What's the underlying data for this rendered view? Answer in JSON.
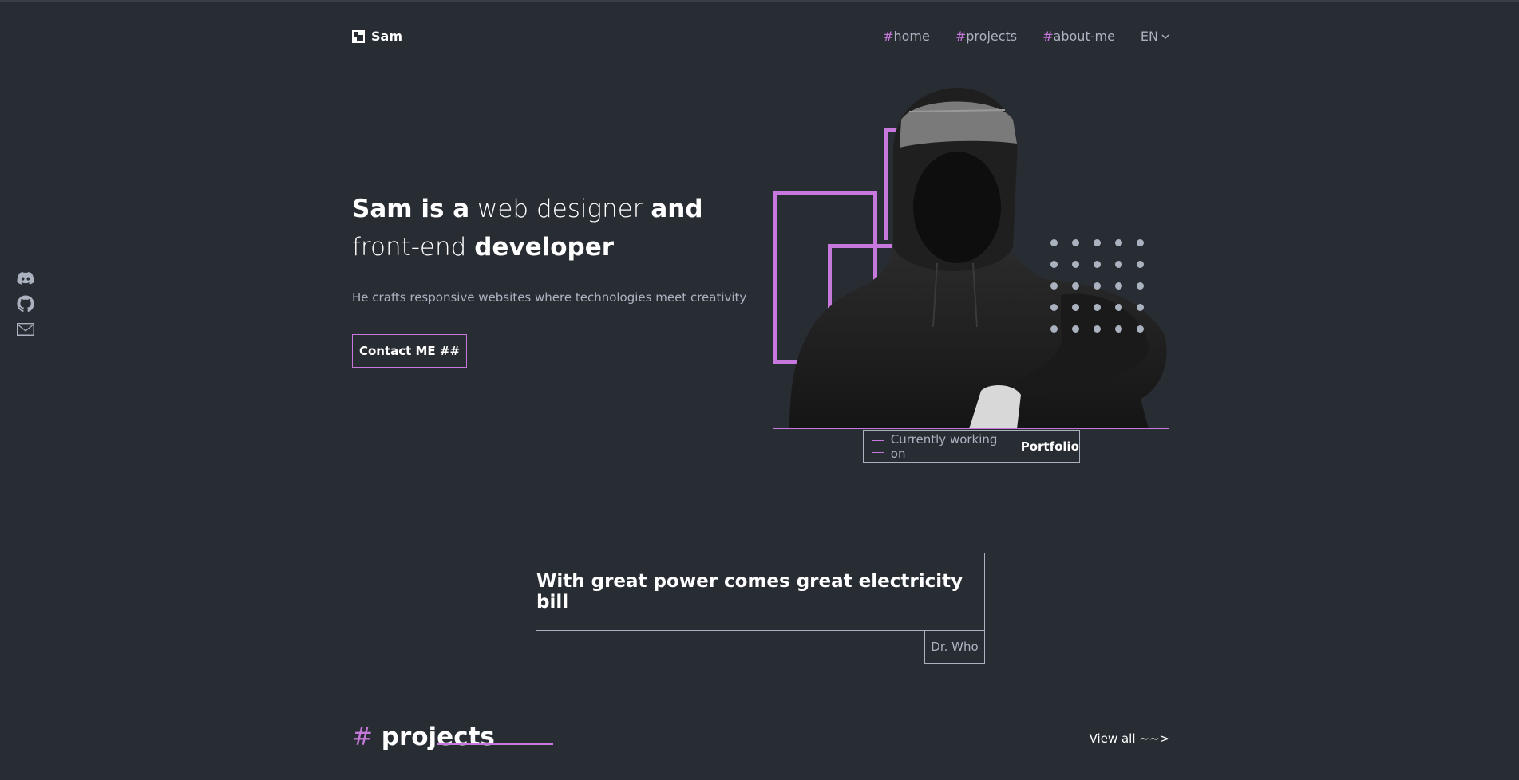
{
  "brand": {
    "name": "Sam",
    "accent_color": "#c778dd",
    "background_color": "#282c33",
    "text_muted_color": "#abb2bf"
  },
  "nav": {
    "items": [
      {
        "hash": "#",
        "label": "home"
      },
      {
        "hash": "#",
        "label": "projects"
      },
      {
        "hash": "#",
        "label": "about-me"
      }
    ],
    "language": "EN"
  },
  "social": {
    "icons": [
      "discord-icon",
      "github-icon",
      "email-icon"
    ]
  },
  "hero": {
    "title_part1": "Sam is a",
    "title_part2": " web designer ",
    "title_part3": "and",
    "title_part4": " front-end ",
    "title_part5": "developer",
    "subtitle": "He crafts responsive websites where technologies meet creativity",
    "cta_label": "Contact ME ##"
  },
  "status": {
    "prefix": "Currently working on",
    "value": "Portfolio"
  },
  "quote": {
    "text": "With great power comes great electricity bill",
    "author": "Dr. Who"
  },
  "projects_section": {
    "hash": "#",
    "title": "projects",
    "view_all": "View all ~~>"
  }
}
